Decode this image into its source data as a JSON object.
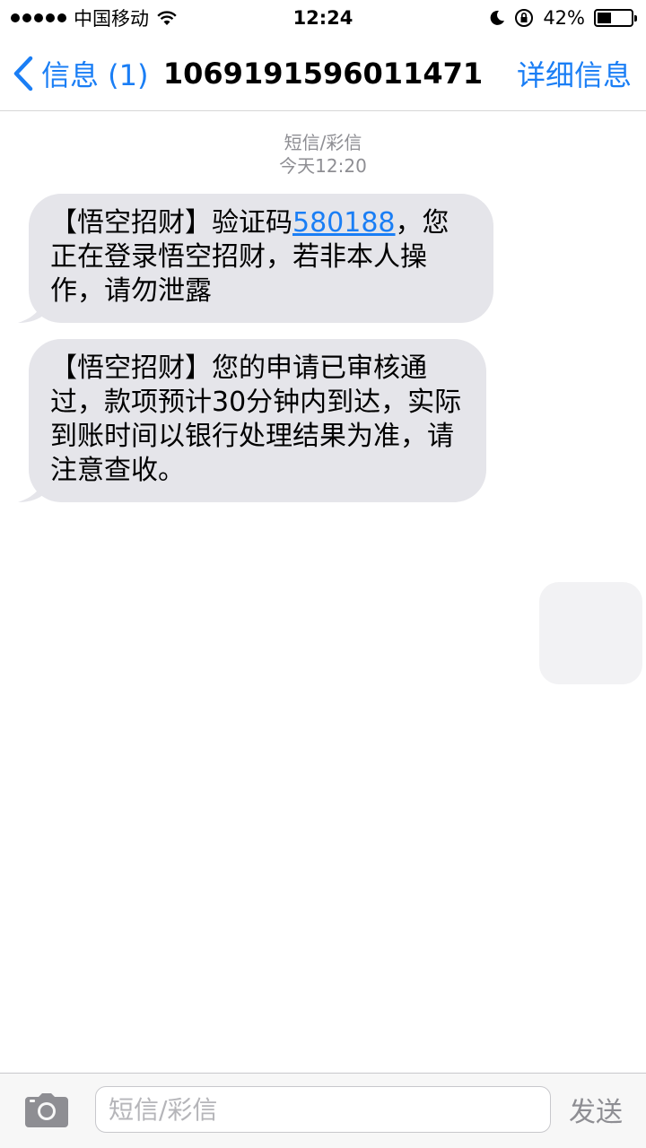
{
  "status_bar": {
    "carrier": "中国移动",
    "time": "12:24",
    "battery_percent": "42%",
    "battery_level": 0.42,
    "icons": [
      "signal-dots-icon",
      "wifi-icon",
      "moon-icon",
      "rotation-lock-icon",
      "battery-icon"
    ]
  },
  "nav": {
    "back_label": "信息 (1)",
    "title": "1069191596011471",
    "detail_label": "详细信息"
  },
  "thread_meta": {
    "type_label": "短信/彩信",
    "timestamp": "今天12:20"
  },
  "messages": [
    {
      "before_code": "【悟空招财】验证码",
      "code": "580188",
      "after_code": "，您正在登录悟空招财，若非本人操作，请勿泄露"
    },
    {
      "text": "【悟空招财】您的申请已审核通过，款项预计30分钟内到达，实际到账时间以银行处理结果为准，请注意查收。"
    }
  ],
  "input_bar": {
    "placeholder": "短信/彩信",
    "send_label": "发送"
  },
  "colors": {
    "accent": "#1a7ef5",
    "bubble": "#e5e5ea",
    "meta_text": "#8e8e93"
  }
}
